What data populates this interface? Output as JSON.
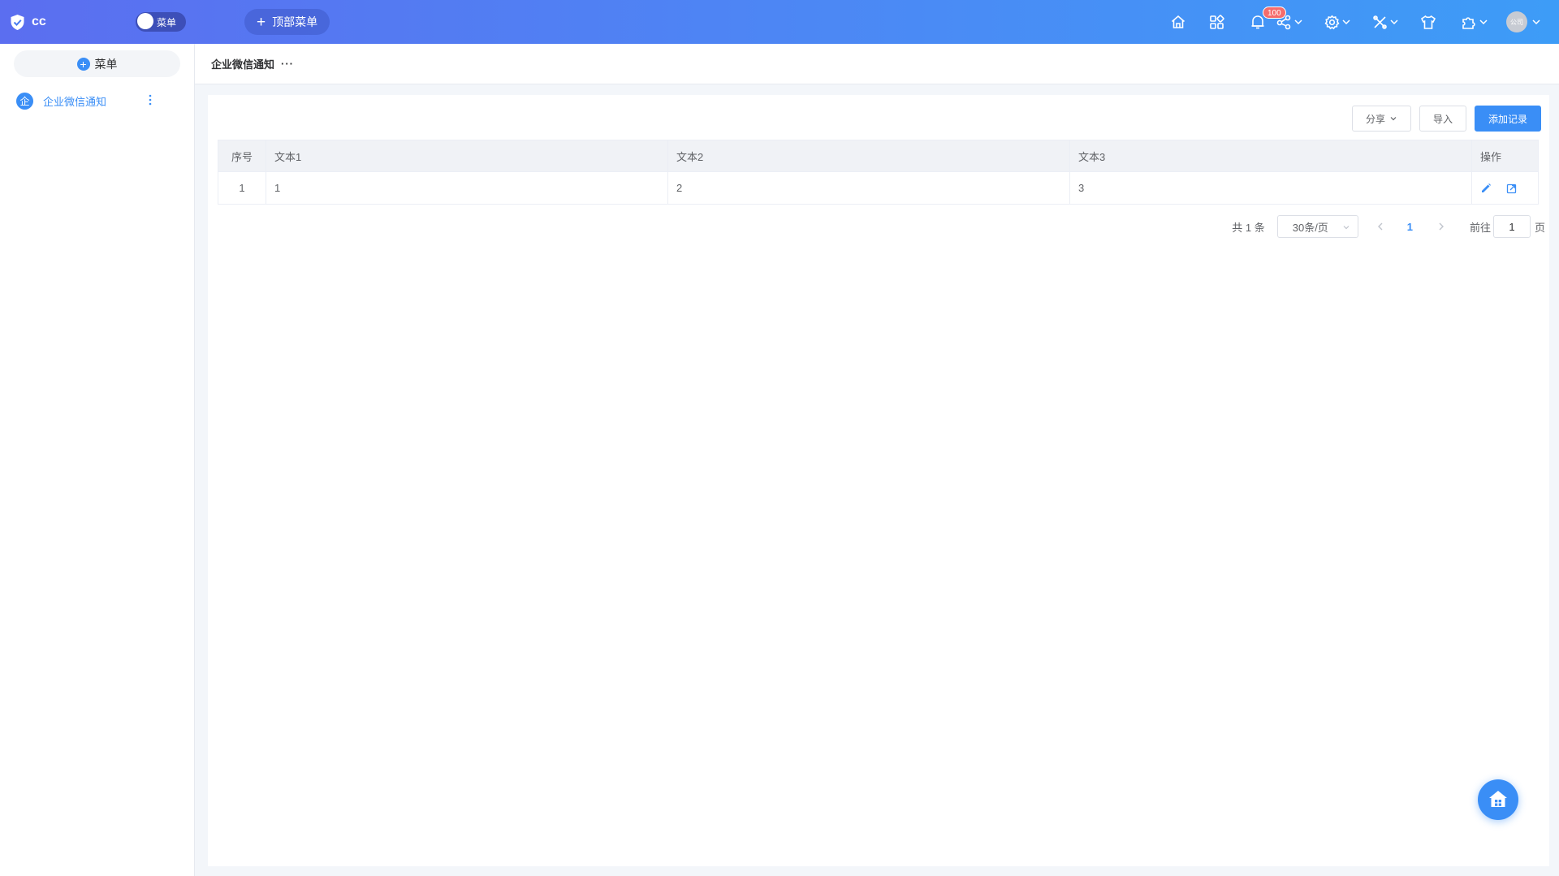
{
  "app": {
    "name": "cc",
    "menu_toggle_label": "菜单",
    "top_menu_label": "顶部菜单",
    "notification_count": "100",
    "avatar_label": "公司"
  },
  "icons": {
    "brand": "shield-check-icon",
    "home": "home-icon",
    "apps": "apps-grid-icon",
    "bell": "bell-icon",
    "share": "share-icon",
    "settings": "gear-icon",
    "tools": "tools-icon",
    "theme": "tshirt-icon",
    "plugin": "puzzle-icon"
  },
  "sidebar": {
    "add_label": "菜单",
    "items": [
      {
        "icon_char": "企",
        "label": "企业微信通知",
        "active": true
      }
    ]
  },
  "tabbar": {
    "title": "企业微信通知",
    "more": "···"
  },
  "toolbar": {
    "share_label": "分享",
    "import_label": "导入",
    "add_label": "添加记录"
  },
  "table": {
    "columns": [
      "序号",
      "文本1",
      "文本2",
      "文本3",
      "操作"
    ],
    "rows": [
      {
        "index": "1",
        "text1": "1",
        "text2": "2",
        "text3": "3"
      }
    ]
  },
  "pagination": {
    "total_label": "共 1 条",
    "page_size": "30条/页",
    "current_page": "1",
    "goto_label": "前往",
    "goto_value": "1",
    "unit_label": "页"
  },
  "colors": {
    "accent": "#3a8ef6",
    "topbar_start": "#5b6ef0",
    "topbar_end": "#3d9cf7",
    "badge": "#f56c6c"
  }
}
